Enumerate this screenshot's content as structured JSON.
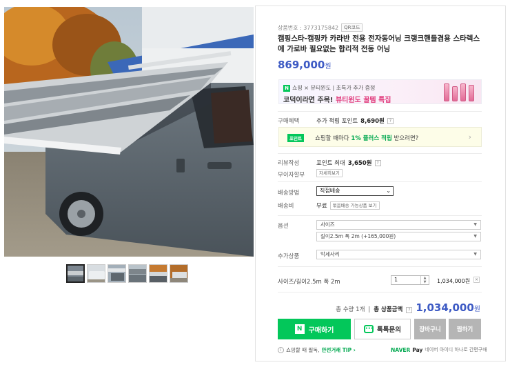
{
  "product": {
    "id_label": "상품번호 : 3773175842",
    "qr_label": "QR코드",
    "title": "캠핑스타-캠핑카 카라반 전용 전자동어닝 크랭크핸들겸용 스타렉스에 가로바 필요없는 합리적 전동 어닝",
    "price": "869,000",
    "price_unit": "원"
  },
  "promo": {
    "line1": "쇼핑 × 뷰티윈도 | 초특가 추가 증정",
    "line2_prefix": "코덕이라면 주목!",
    "line2_highlight": "뷰티윈도 꿀템 특집"
  },
  "benefits": {
    "label": "구매혜택",
    "text_prefix": "추가 적립 포인트",
    "points": "8,690원",
    "box_badge": "포인트",
    "box_text_prefix": "쇼핑할 때마다",
    "box_highlight": "1% 플러스 적립",
    "box_text_suffix": "받으려면?"
  },
  "review": {
    "label": "리뷰작성",
    "text_prefix": "포인트 최대",
    "points": "3,650원"
  },
  "installment": {
    "label": "무이자할부",
    "button": "자세히보기"
  },
  "shipping": {
    "method_label": "배송방법",
    "method_value": "직접배송",
    "fee_label": "배송비",
    "fee_value": "무료",
    "fee_button": "묶음배송 가능상품 보기"
  },
  "options": {
    "label": "옵션",
    "size_select": "사이즈",
    "size_selected": "길이2.5m 폭 2m (+165,000원)"
  },
  "addon": {
    "label": "추가상품",
    "select": "악세사리"
  },
  "selected": {
    "name": "사이즈/길이2.5m 폭 2m",
    "qty": "1",
    "price": "1,034,000원"
  },
  "total": {
    "qty_text": "총 수량 1개",
    "label": "총 상품금액",
    "amount": "1,034,000",
    "unit": "원"
  },
  "actions": {
    "buy": "구매하기",
    "talk": "톡톡문의",
    "cart": "장바구니",
    "wish": "찜하기"
  },
  "footer": {
    "tip_prefix": "쇼핑할 때 필독,",
    "tip_link": "안전거래 TIP ›",
    "npay_brand": "NAVER",
    "npay_pay": "Pay",
    "npay_text": "네이버 아이디 하나로 간편구매"
  },
  "colors": {
    "accent_blue": "#3d5ac4",
    "naver_green": "#03c75a"
  }
}
